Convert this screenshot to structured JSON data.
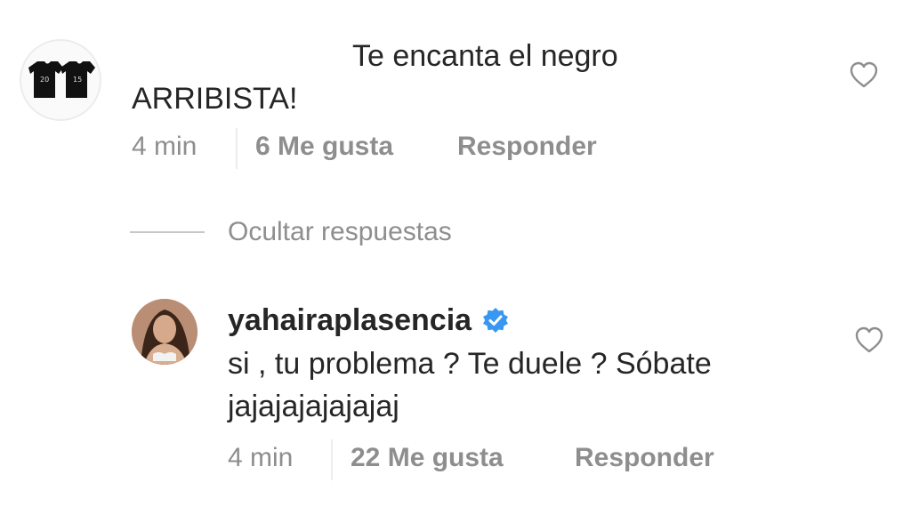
{
  "comments": [
    {
      "avatar_icon": "tshirts-avatar",
      "line1": "Te encanta el negro",
      "line2": "ARRIBISTA!",
      "time": "4 min",
      "likes": "6 Me gusta",
      "reply": "Responder",
      "like_icon": "heart-outline-icon"
    }
  ],
  "replies_toggle": {
    "label": "Ocultar respuestas"
  },
  "replies": [
    {
      "avatar_icon": "profile-photo-avatar",
      "username": "yahairaplasencia",
      "verified_icon": "verified-badge-icon",
      "line1": "si , tu problema ? Te duele ? Sóbate",
      "line2": "jajajajajajajaj",
      "time": "4 min",
      "likes": "22 Me gusta",
      "reply": "Responder",
      "like_icon": "heart-outline-icon"
    }
  ],
  "colors": {
    "text": "#262626",
    "secondary": "#8e8e8e",
    "verified": "#3897f0"
  }
}
